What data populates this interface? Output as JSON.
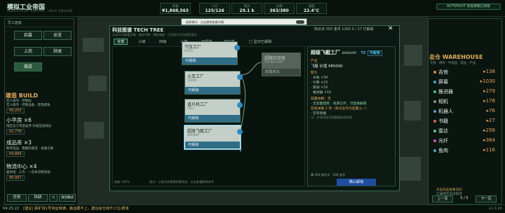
{
  "app": {
    "title": "模拟工业帝国",
    "subtitle": "INDUSTRIAL EMPIRE · IDLE ENGINE"
  },
  "resources": [
    {
      "label": "资金",
      "value": "¥1,868,563"
    },
    {
      "label": "人口",
      "value": "125/126"
    },
    {
      "label": "电力",
      "value": "29.1 k"
    },
    {
      "label": "仓储",
      "value": "363/380"
    },
    {
      "label": "温度",
      "value": "22.4°C"
    }
  ],
  "autopilot": {
    "label": "AUTOPILOT 智能策略已接管"
  },
  "search_overlay": {
    "text": "搜索模式 · 点击建筑查看详情"
  },
  "left_panel": {
    "title": "员工面板",
    "buttons": [
      "招募",
      "总览",
      "上岗",
      "辞退",
      "商店"
    ],
    "build_header": "建造 BUILD",
    "build_items": [
      {
        "name": "小平房 ×6",
        "desc": "指定员工宅宿舍开·升级宜居快乐",
        "price": "¥2,776"
      },
      {
        "name": "成品库 ×3",
        "desc": "暂存成品 · 需搬料建造 · 关联仓库",
        "price": "¥4,899"
      },
      {
        "name": "物流中心 ×4",
        "desc": "面供电 · 工作 · 一车体点物流地",
        "price": "¥6,997"
      }
    ],
    "first_item": {
      "name": "无人值守 · 控制站",
      "desc": "无人值守 · 控制设备 · 获电费免",
      "price": "¥9,253"
    },
    "bottom_buttons": [
      "任务",
      "科研",
      "<",
      "清货模式"
    ]
  },
  "modal": {
    "title": "科技图谱  TECH TREE",
    "hint": "点击节点查看详情 · 拖动平移 · 滚轮缩放 · 已完成节点为高亮显示",
    "stats": "知识点 302  金币 1293  0 / 27  已解锁",
    "tabs": [
      "全部",
      "三级",
      "四级",
      "三级",
      "已解锁",
      "已完成"
    ],
    "filter_label": "□ 显示已解锁",
    "nodes": [
      {
        "name": "火车工厂",
        "sub": "TRAIN",
        "status": "可解锁"
      },
      {
        "name": "直升机工厂",
        "sub": "HELI",
        "status": "可解锁"
      },
      {
        "name": "超级飞艇工厂",
        "sub": "AIRSHIP",
        "status": "可解锁"
      },
      {
        "name": "汽车工厂",
        "sub": "AUTO",
        "status": "可解锁"
      },
      {
        "name": "超限实验室",
        "sub": "SUPERCOMP",
        "status": "前置未达"
      }
    ],
    "tree_footer": "提示：三级科技需要前置完成 · 点击查看解锁条件",
    "tree_zoom": "缩放 100%",
    "detail": {
      "title": "超级飞艇工厂",
      "sub": "AIRSHIP",
      "tier": "T3",
      "status": "可解锁",
      "desc_top": "产出",
      "output": "飞艇 价值 ¥85000",
      "recipe_header": "配方",
      "recipe": [
        "· 木板 ×30",
        "· 引擎 ×15",
        "· 玻璃 ×10",
        "· 推进器 ×10"
      ],
      "req_header": "前置依赖：无",
      "req_lines": [
        "· 无前置建筑 · 资源已齐，可直接解锁",
        "后续关联 1 项（高点击作为后置之一）",
        "· 空军母舰"
      ],
      "req_note": "注：后续科技可能需要其他资源",
      "cost_line": "需 200 知识点 · 300 金币",
      "confirm": "确认解锁"
    }
  },
  "warehouse": {
    "header": "总仓 WAREHOUSE",
    "sub": "全部 · 原料 · 半成品 · 成品 · 产品",
    "items": [
      {
        "name": "吉他",
        "qty": "▸138",
        "color": "#d88a3a"
      },
      {
        "name": "屏幕",
        "qty": "▸1030",
        "color": "#3fb0d3"
      },
      {
        "name": "推进器",
        "qty": "▸279",
        "color": "#4bbf7b"
      },
      {
        "name": "相机",
        "qty": "▸178",
        "color": "#8a8f8c"
      },
      {
        "name": "机器人",
        "qty": "▸76",
        "color": "#5c9bd6"
      },
      {
        "name": "书籍",
        "qty": "▸27",
        "color": "#d06d5b"
      },
      {
        "name": "雷达",
        "qty": "▸256",
        "color": "#5ecb8e"
      },
      {
        "name": "光纤",
        "qty": "▸364",
        "color": "#c75cc0"
      },
      {
        "name": "鱼肉",
        "qty": "▸116",
        "color": "#4aa3c6"
      }
    ],
    "hints": [
      "点击商品查看流向",
      "已满库存自动暂停"
    ],
    "pager": {
      "prev": "上一页",
      "page": "5 / 5",
      "next": "下一页"
    }
  },
  "statusbar": {
    "time": "04:25:22",
    "message": "[建议] 顾矿场1号待运堆满，搬运跟不上，建议给仓库升工位/费率",
    "version": "v1.0.26"
  }
}
